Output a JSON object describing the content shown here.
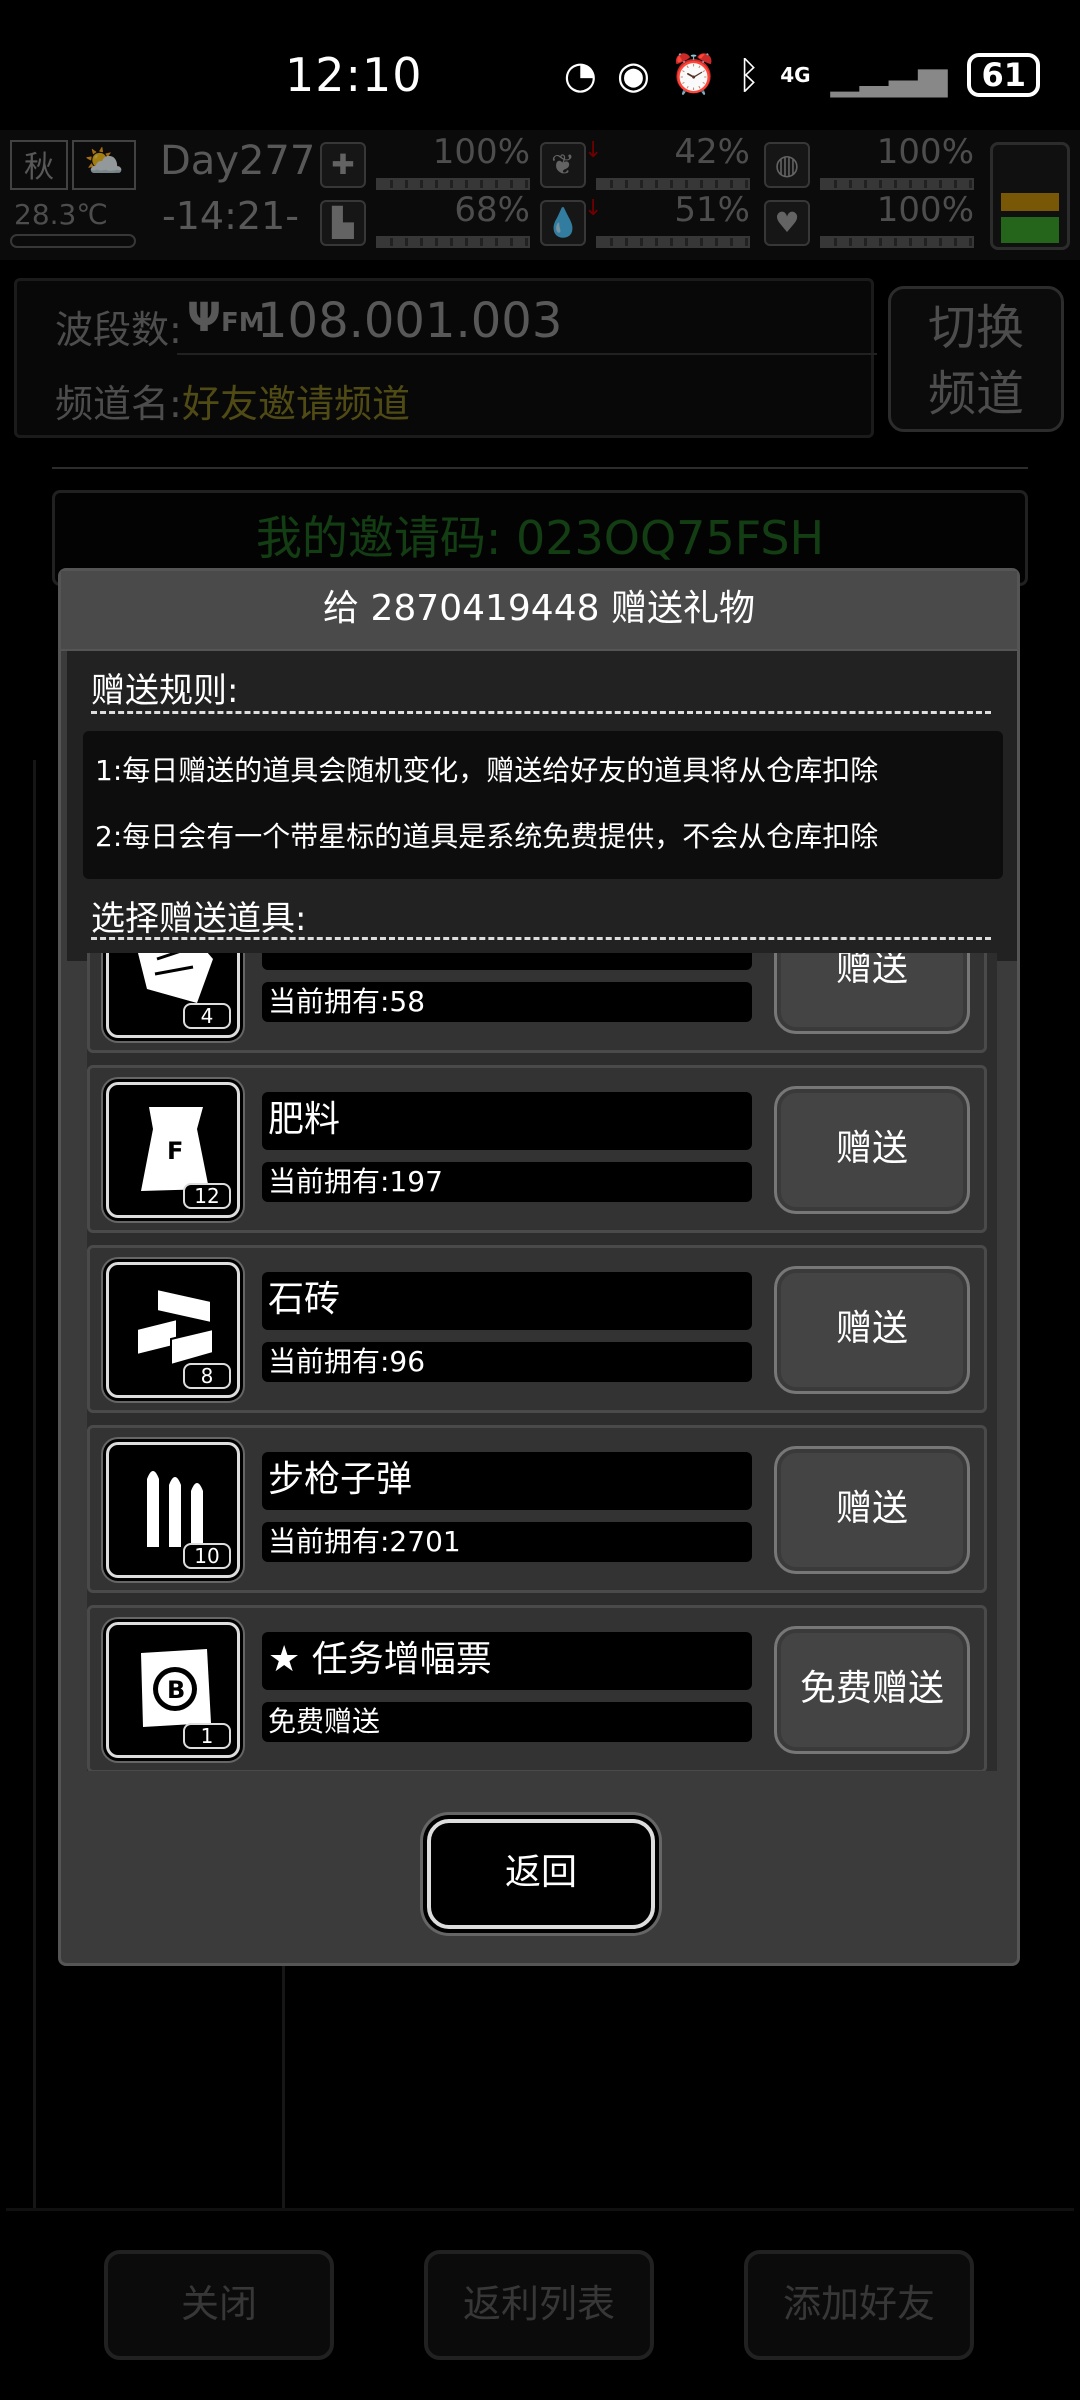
{
  "status_bar": {
    "time": "12:10",
    "network": "4G",
    "battery": "61",
    "icons": [
      "speed-icon",
      "eye-icon",
      "alarm-icon",
      "bluetooth-icon",
      "signal-icon",
      "battery-icon"
    ]
  },
  "hud": {
    "season": "秋",
    "temperature": "28.3℃",
    "day": "Day277",
    "clock": "-14:21-",
    "stats": [
      {
        "name": "health",
        "value": "100%"
      },
      {
        "name": "hunger",
        "value": "42%"
      },
      {
        "name": "defense",
        "value": "100%"
      },
      {
        "name": "stamina",
        "value": "68%"
      },
      {
        "name": "water",
        "value": "51%"
      },
      {
        "name": "mood",
        "value": "100%"
      }
    ]
  },
  "radio": {
    "band_label": "波段数:",
    "fm_label": "FM",
    "frequency": "108.001.003",
    "channel_label": "频道名:",
    "channel_name": "好友邀请频道",
    "switch_button": "切换\n频道"
  },
  "invite_code": "我的邀请码: 023OQ75FSH",
  "bottom_buttons": {
    "close": "关闭",
    "rebate_list": "返利列表",
    "add_friend": "添加好友"
  },
  "modal": {
    "title": "给 2870419448 赠送礼物",
    "rules_header": "赠送规则:",
    "rule_1": "1:每日赠送的道具会随机变化，赠送给好友的道具将从仓库扣除",
    "rule_2": "2:每日会有一个带星标的道具是系统免费提供，不会从仓库扣除",
    "select_header": "选择赠送道具:",
    "items": [
      {
        "name": "",
        "owned": "当前拥有:58",
        "qty": "4",
        "button": "赠送",
        "icon": "cloth-icon"
      },
      {
        "name": "肥料",
        "owned": "当前拥有:197",
        "qty": "12",
        "button": "赠送",
        "icon": "fertilizer-bag-icon"
      },
      {
        "name": "石砖",
        "owned": "当前拥有:96",
        "qty": "8",
        "button": "赠送",
        "icon": "bricks-icon"
      },
      {
        "name": "步枪子弹",
        "owned": "当前拥有:2701",
        "qty": "10",
        "button": "赠送",
        "icon": "rifle-bullets-icon"
      },
      {
        "name": "★ 任务增幅票",
        "owned": "免费赠送",
        "qty": "1",
        "button": "免费赠送",
        "icon": "ticket-icon"
      }
    ],
    "back_button": "返回"
  }
}
